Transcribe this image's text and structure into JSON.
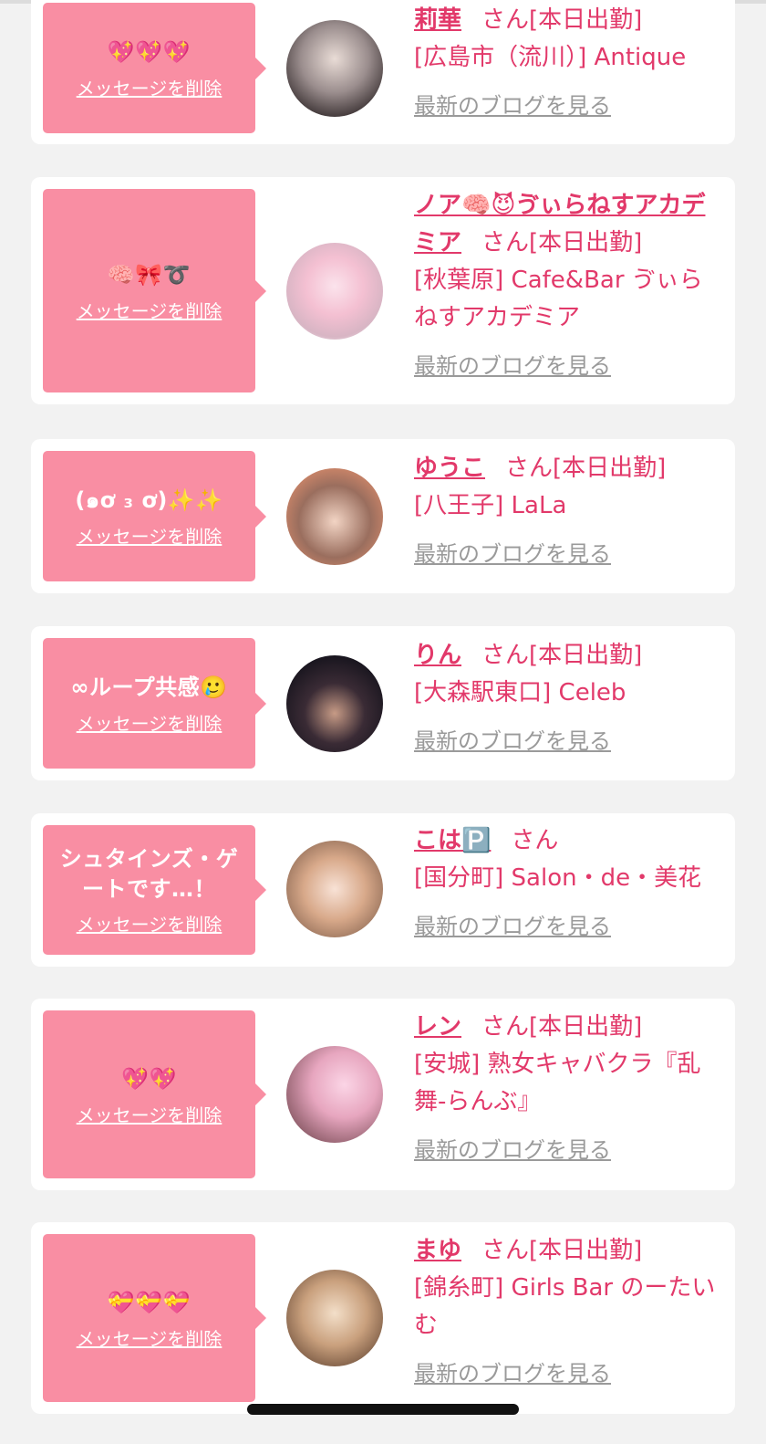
{
  "items": [
    {
      "message": "💖💖💖",
      "delete_label": "メッセージを削除",
      "name": "莉華",
      "honorific": "さん[本日出勤]",
      "shop": "[広島市（流川）] Antique",
      "blog_label": "最新のブログを見る"
    },
    {
      "message": "🧠🎀➰",
      "delete_label": "メッセージを削除",
      "name": "ノア🧠😈ゔぃらねすアカデミア",
      "honorific": "さん[本日出勤]",
      "shop": "[秋葉原] Cafe&Bar ゔぃらねすアカデミア",
      "blog_label": "最新のブログを見る"
    },
    {
      "message": "(๑ơ ₃ ơ)✨✨",
      "delete_label": "メッセージを削除",
      "name": "ゆうこ",
      "honorific": "さん[本日出勤]",
      "shop": "[八王子] LaLa",
      "blog_label": "最新のブログを見る"
    },
    {
      "message": "∞ループ共感🥲",
      "delete_label": "メッセージを削除",
      "name": "りん",
      "honorific": "さん[本日出勤]",
      "shop": "[大森駅東口] Celeb",
      "blog_label": "最新のブログを見る"
    },
    {
      "message": "シュタインズ・ゲートです…！",
      "delete_label": "メッセージを削除",
      "name": "こは🅿️",
      "honorific": "さん",
      "shop": "[国分町] Salon・de・美花",
      "blog_label": "最新のブログを見る"
    },
    {
      "message": "💖💖",
      "delete_label": "メッセージを削除",
      "name": "レン",
      "honorific": "さん[本日出勤]",
      "shop": "[安城] 熟女キャバクラ『乱舞-らんぶ』",
      "blog_label": "最新のブログを見る"
    },
    {
      "message": "💝💝💝",
      "delete_label": "メッセージを削除",
      "name": "まゆ",
      "honorific": "さん[本日出勤]",
      "shop": "[錦糸町] Girls Bar のーたいむ",
      "blog_label": "最新のブログを見る"
    }
  ],
  "colors": {
    "accent": "#e2396a",
    "bubble": "#f98ea3",
    "muted": "#9a9a9a",
    "background": "#f2f2f2"
  }
}
